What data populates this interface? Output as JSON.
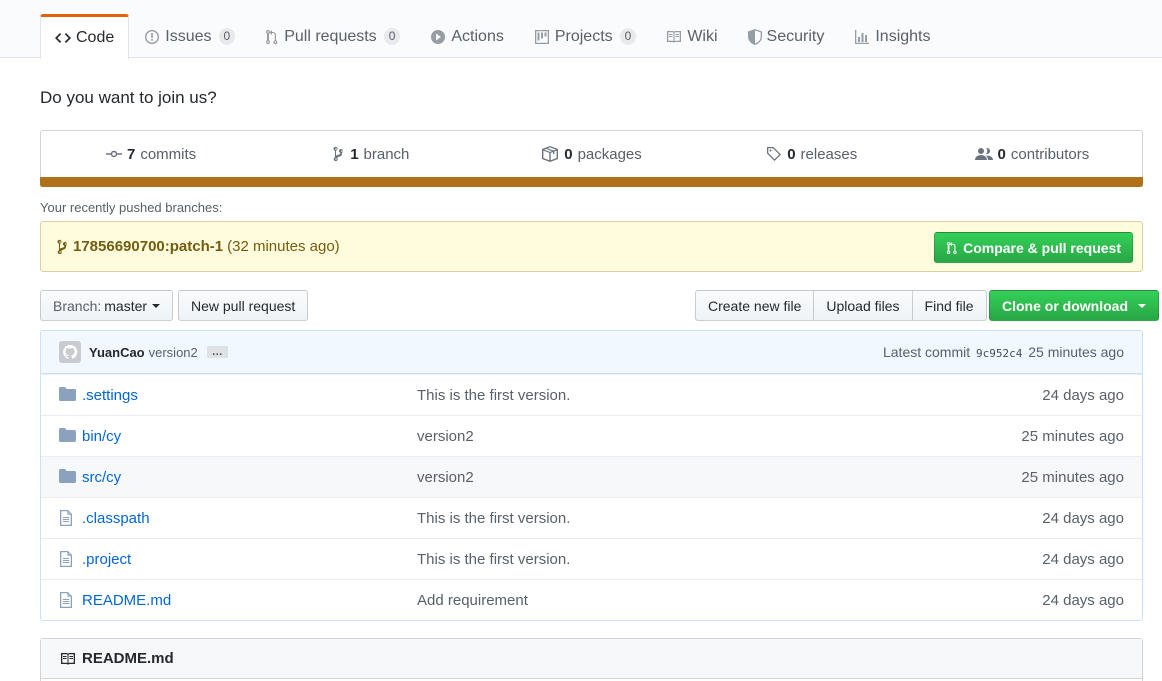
{
  "tabs": [
    {
      "label": "Code",
      "icon": "code-icon",
      "selected": true
    },
    {
      "label": "Issues",
      "count": "0",
      "icon": "issue-icon"
    },
    {
      "label": "Pull requests",
      "count": "0",
      "icon": "pull-request-icon"
    },
    {
      "label": "Actions",
      "icon": "play-icon"
    },
    {
      "label": "Projects",
      "count": "0",
      "icon": "project-icon"
    },
    {
      "label": "Wiki",
      "icon": "book-icon"
    },
    {
      "label": "Security",
      "icon": "shield-icon"
    },
    {
      "label": "Insights",
      "icon": "graph-icon"
    }
  ],
  "description": "Do you want to join us?",
  "summary": {
    "commits": {
      "count": "7",
      "label": "commits"
    },
    "branches": {
      "count": "1",
      "label": "branch"
    },
    "packages": {
      "count": "0",
      "label": "packages"
    },
    "releases": {
      "count": "0",
      "label": "releases"
    },
    "contributors": {
      "count": "0",
      "label": "contributors"
    },
    "language_color": "#b07219"
  },
  "recent": {
    "label": "Your recently pushed branches:",
    "branch": "17856690700:patch-1",
    "time": "(32 minutes ago)",
    "compare_label": "Compare & pull request"
  },
  "toolbar": {
    "branch_prefix": "Branch:",
    "branch_name": "master",
    "new_pr": "New pull request",
    "create_file": "Create new file",
    "upload_files": "Upload files",
    "find_file": "Find file",
    "clone": "Clone or download"
  },
  "commit": {
    "author": "YuanCao",
    "message": "version2",
    "ellipsis": "…",
    "latest_label": "Latest commit",
    "sha": "9c952c4",
    "age": "25 minutes ago"
  },
  "files": [
    {
      "type": "dir",
      "name": ".settings",
      "message": "This is the first version.",
      "age": "24 days ago"
    },
    {
      "type": "dir",
      "name": "bin/cy",
      "message": "version2",
      "age": "25 minutes ago"
    },
    {
      "type": "dir",
      "name": "src/cy",
      "message": "version2",
      "age": "25 minutes ago"
    },
    {
      "type": "file",
      "name": ".classpath",
      "message": "This is the first version.",
      "age": "24 days ago"
    },
    {
      "type": "file",
      "name": ".project",
      "message": "This is the first version.",
      "age": "24 days ago"
    },
    {
      "type": "file",
      "name": "README.md",
      "message": "Add requirement",
      "age": "24 days ago"
    }
  ],
  "readme": {
    "title": "README.md"
  },
  "colors": {
    "accent": "#e36209",
    "link": "#0366d6",
    "green": "#28a745"
  }
}
